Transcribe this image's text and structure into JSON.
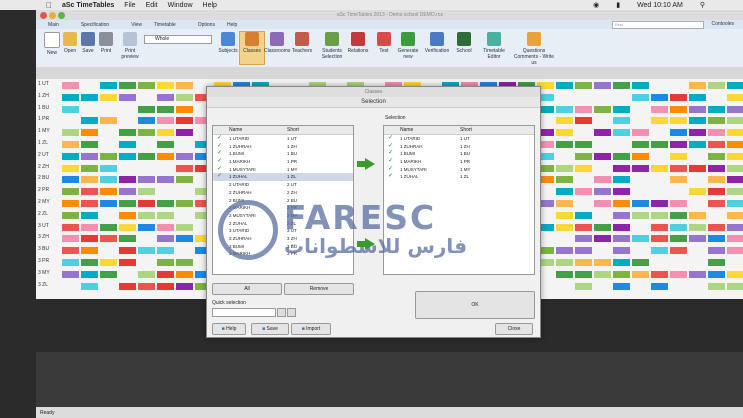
{
  "menubar": {
    "app": "aSc TimeTables",
    "items": [
      "File",
      "Edit",
      "Window",
      "Help"
    ],
    "clock": "Wed 10:10 AM"
  },
  "window": {
    "title": "aSc TimeTables 2013 - Demo school DEMO.roz"
  },
  "ribbon": {
    "tabs": [
      "Main",
      "Specification",
      "View",
      "Timetable",
      "Options",
      "Help"
    ],
    "search_placeholder": "Find",
    "cb_label": "Contooles"
  },
  "toolbar": {
    "items": [
      "New",
      "Open",
      "Save",
      "Print",
      "Print preview",
      "Subjects",
      "Classes",
      "Classrooms",
      "Teachers",
      "Students Selection",
      "Relations",
      "Test",
      "Generate new",
      "Verification",
      "School",
      "Timetable Editor",
      "Questions Comments - Write us"
    ],
    "view_select": "Whole"
  },
  "grid": {
    "row_labels": [
      "1 UT",
      "1 ZH",
      "1 BU",
      "1 PR",
      "1 MY",
      "1 ZL",
      "2 UT",
      "2 ZH",
      "2 BU",
      "2 PR",
      "2 MY",
      "2 ZL",
      "3 UT",
      "3 ZH",
      "3 BU",
      "3 PR",
      "3 MY",
      "3 ZL"
    ]
  },
  "dialog": {
    "title": "Classes",
    "subtitle": "Selection",
    "left_headers": [
      "Name",
      "Short"
    ],
    "left_items": [
      {
        "name": "1 UTARID",
        "short": "1 UT",
        "checked": true
      },
      {
        "name": "1 ZUHRAH",
        "short": "1 ZH",
        "checked": true
      },
      {
        "name": "1 BUMI",
        "short": "1 BU",
        "checked": true
      },
      {
        "name": "1 MARIKH",
        "short": "1 PR",
        "checked": true
      },
      {
        "name": "1 MUSYTARI",
        "short": "1 MY",
        "checked": true
      },
      {
        "name": "1 ZUHAL",
        "short": "1 ZL",
        "checked": true
      },
      {
        "name": "2 UTARID",
        "short": "2 UT",
        "checked": false
      },
      {
        "name": "2 ZUHRAH",
        "short": "2 ZH",
        "checked": false
      },
      {
        "name": "2 BUMI",
        "short": "2 BU",
        "checked": false
      },
      {
        "name": "2 MARIKH",
        "short": "2 PR",
        "checked": false
      },
      {
        "name": "2 MUSYTARI",
        "short": "2 MY",
        "checked": false
      },
      {
        "name": "2 ZUHAL",
        "short": "2 ZL",
        "checked": false
      },
      {
        "name": "3 UTARID",
        "short": "3 UT",
        "checked": false
      },
      {
        "name": "3 ZUHRAH",
        "short": "3 ZH",
        "checked": false
      },
      {
        "name": "3 BUMI",
        "short": "3 BU",
        "checked": false
      },
      {
        "name": "3 MARIKH",
        "short": "3 PR",
        "checked": false
      }
    ],
    "right_label": "Selection",
    "right_headers": [
      "Name",
      "Short"
    ],
    "right_items": [
      {
        "name": "1 UTARID",
        "short": "1 UT"
      },
      {
        "name": "1 ZUHRAH",
        "short": "1 ZH"
      },
      {
        "name": "1 BUMI",
        "short": "1 BU"
      },
      {
        "name": "1 MARIKH",
        "short": "1 PR"
      },
      {
        "name": "1 MUSYTARI",
        "short": "1 MY"
      },
      {
        "name": "1 ZUHAL",
        "short": "1 ZL"
      }
    ],
    "all_label": "All",
    "remove_label": "Remove",
    "quick_selection_label": "Quick selection",
    "ok_label": "OK",
    "help_label": "Help",
    "save_label": "Save",
    "import_label": "Import",
    "close_label": "Close"
  },
  "watermark": {
    "latin": "FARESC",
    "arabic": "فارس للاسطوانات"
  },
  "status": {
    "text": "Ready"
  }
}
